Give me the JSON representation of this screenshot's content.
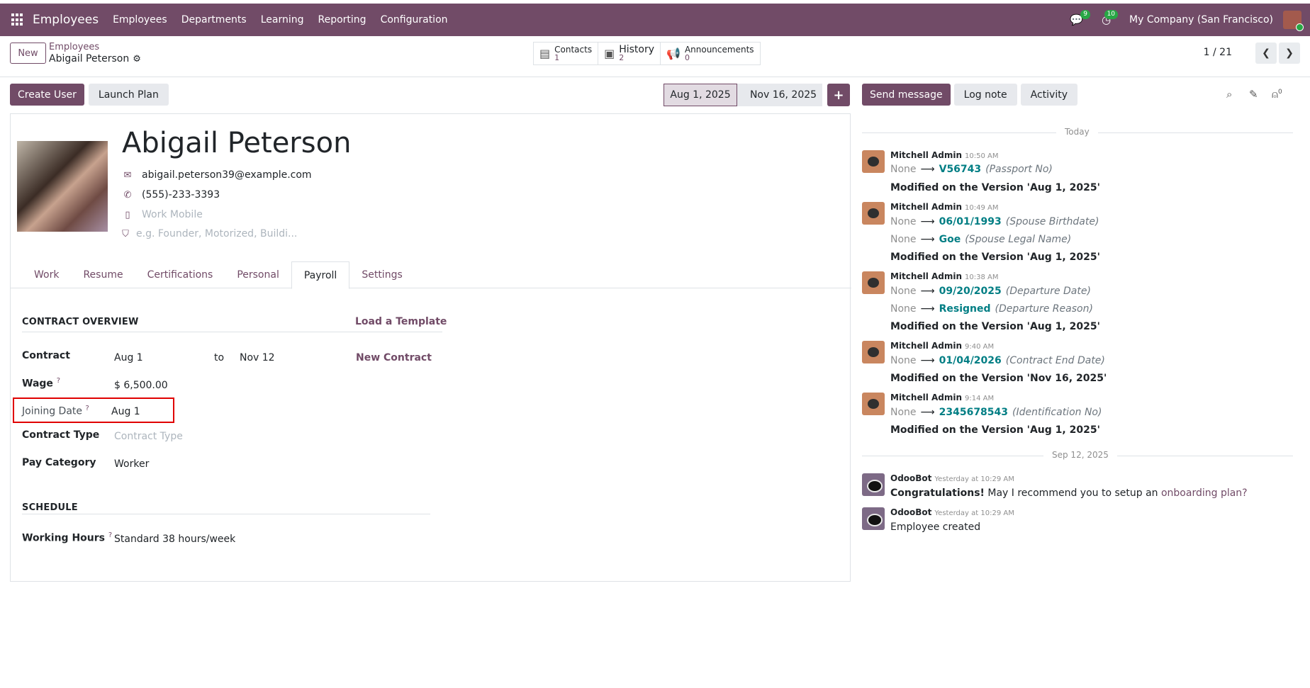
{
  "topbar": {
    "app": "Employees",
    "menus": [
      "Employees",
      "Departments",
      "Learning",
      "Reporting",
      "Configuration"
    ],
    "messages_count": "9",
    "activities_count": "10",
    "company": "My Company (San Francisco)"
  },
  "control": {
    "new_label": "New",
    "breadcrumb_parent": "Employees",
    "breadcrumb_current": "Abigail Peterson",
    "smart_buttons": [
      {
        "label": "Contacts",
        "count": "1"
      },
      {
        "label": "History",
        "count": "2"
      },
      {
        "label": "Announcements",
        "count": "0"
      }
    ],
    "pager": "1 / 21"
  },
  "actions": {
    "create_user": "Create User",
    "launch_plan": "Launch Plan",
    "version_1": "Aug 1, 2025",
    "version_2": "Nov 16, 2025",
    "add": "+"
  },
  "employee": {
    "name": "Abigail Peterson",
    "email": "abigail.peterson39@example.com",
    "phone": "(555)-233-3393",
    "mobile_placeholder": "Work Mobile",
    "tags_placeholder": "e.g. Founder, Motorized, Buildi..."
  },
  "tabs": [
    "Work",
    "Resume",
    "Certifications",
    "Personal",
    "Payroll",
    "Settings"
  ],
  "active_tab": "Payroll",
  "payroll": {
    "contract_overview": "CONTRACT OVERVIEW",
    "load_template": "Load a Template",
    "contract_label": "Contract",
    "contract_start": "Aug 1",
    "to": "to",
    "contract_end": "Nov 12",
    "new_contract": "New Contract",
    "wage_label": "Wage",
    "wage_value": "$ 6,500.00",
    "joining_label": "Joining Date",
    "joining_value": "Aug 1",
    "contract_type_label": "Contract Type",
    "contract_type_placeholder": "Contract Type",
    "pay_category_label": "Pay Category",
    "pay_category_value": "Worker",
    "schedule": "SCHEDULE",
    "working_hours_label": "Working Hours",
    "working_hours_value": "Standard 38 hours/week",
    "help_mark": "?"
  },
  "chatter": {
    "send_message": "Send message",
    "log_note": "Log note",
    "activity": "Activity",
    "followers_count": "0",
    "sep_today": "Today",
    "sep_date": "Sep 12, 2025",
    "messages": [
      {
        "author": "Mitchell Admin",
        "time": "10:50 AM",
        "changes": [
          {
            "old": "None",
            "new": "V56743",
            "field": "(Passport No)"
          }
        ],
        "note": "Modified on the Version 'Aug 1, 2025'"
      },
      {
        "author": "Mitchell Admin",
        "time": "10:49 AM",
        "changes": [
          {
            "old": "None",
            "new": "06/01/1993",
            "field": "(Spouse Birthdate)"
          },
          {
            "old": "None",
            "new": "Goe",
            "field": "(Spouse Legal Name)"
          }
        ],
        "note": "Modified on the Version 'Aug 1, 2025'"
      },
      {
        "author": "Mitchell Admin",
        "time": "10:38 AM",
        "changes": [
          {
            "old": "None",
            "new": "09/20/2025",
            "field": "(Departure Date)"
          },
          {
            "old": "None",
            "new": "Resigned",
            "field": "(Departure Reason)"
          }
        ],
        "note": "Modified on the Version 'Aug 1, 2025'"
      },
      {
        "author": "Mitchell Admin",
        "time": "9:40 AM",
        "changes": [
          {
            "old": "None",
            "new": "01/04/2026",
            "field": "(Contract End Date)"
          }
        ],
        "note": "Modified on the Version 'Nov 16, 2025'"
      },
      {
        "author": "Mitchell Admin",
        "time": "9:14 AM",
        "changes": [
          {
            "old": "None",
            "new": "2345678543",
            "field": "(Identification No)"
          }
        ],
        "note": "Modified on the Version 'Aug 1, 2025'"
      }
    ],
    "bot_messages": [
      {
        "author": "OdooBot",
        "time": "Yesterday at 10:29 AM",
        "bold": "Congratulations!",
        "text": " May I recommend you to setup an ",
        "link": "onboarding plan?"
      },
      {
        "author": "OdooBot",
        "time": "Yesterday at 10:29 AM",
        "text": "Employee created"
      }
    ]
  }
}
